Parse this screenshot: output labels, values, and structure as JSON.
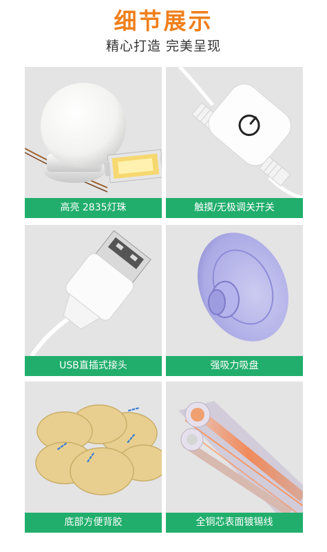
{
  "header": {
    "title": "细节展示",
    "subtitle": "精心打造 完美呈现"
  },
  "cards": [
    {
      "label": "高亮 2835灯珠",
      "icon": "led-bulb-icon"
    },
    {
      "label": "触摸/无极调关开关",
      "icon": "touch-switch-icon"
    },
    {
      "label": "USB直插式接头",
      "icon": "usb-plug-icon"
    },
    {
      "label": "强吸力吸盘",
      "icon": "suction-cup-icon"
    },
    {
      "label": "底部方便背胶",
      "icon": "adhesive-pads-icon"
    },
    {
      "label": "全铜芯表面镀锡线",
      "icon": "copper-wire-icon"
    }
  ],
  "colors": {
    "title": "#f07f1a",
    "label_bg": "#21ae6c",
    "card_bg": "#e4e4e4"
  }
}
